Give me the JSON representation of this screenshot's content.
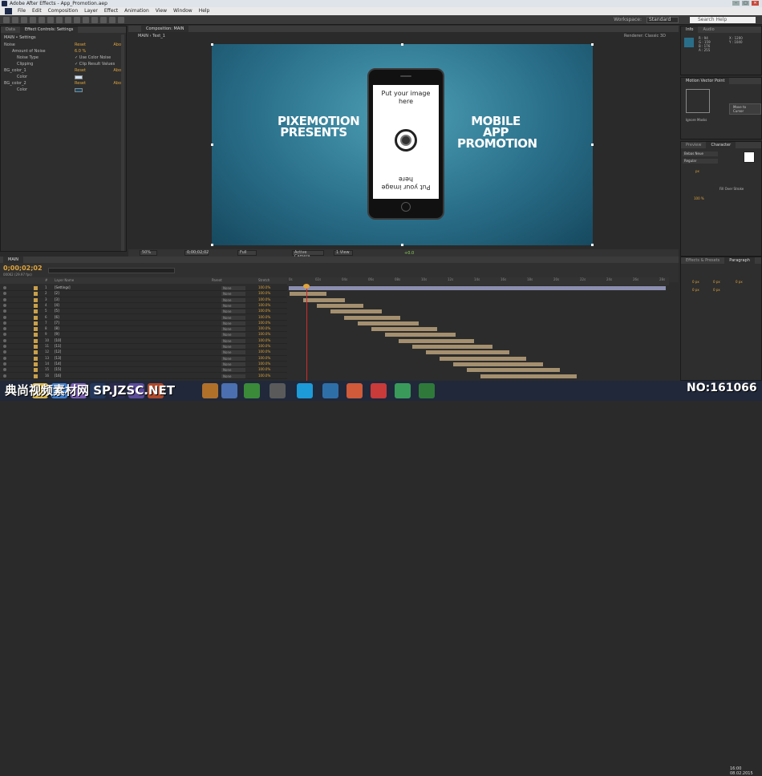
{
  "window": {
    "title": "Adobe After Effects - App_Promotion.aep",
    "buttons": [
      "–",
      "□",
      "✕"
    ]
  },
  "menu": [
    "File",
    "Edit",
    "Composition",
    "Layer",
    "Effect",
    "Animation",
    "View",
    "Window",
    "Help"
  ],
  "toolbar": {
    "workspace_label": "Workspace:",
    "workspace_value": "Standard",
    "search_placeholder": "Search Help"
  },
  "effect_controls": {
    "tabs": [
      "Data",
      "Effect Controls: Settings"
    ],
    "path": "MAIN • Settings",
    "rows": [
      {
        "label": "Noise",
        "reset": "Reset",
        "about": "Abo"
      },
      {
        "label": "Amount of Noise",
        "value": "6.0 %"
      },
      {
        "label": "Noise Type",
        "value": "✓ Use Color Noise"
      },
      {
        "label": "Clipping",
        "value": "✓ Clip Result Values"
      },
      {
        "label": "BG_color_1",
        "reset": "Reset",
        "about": "Abo"
      },
      {
        "label": "Color",
        "swatch": true
      },
      {
        "label": "BG_color_2",
        "reset": "Reset",
        "about": "Abo"
      },
      {
        "label": "Color",
        "swatch": true
      }
    ]
  },
  "composition": {
    "tab": "Composition: MAIN",
    "crumbs": [
      "MAIN",
      "Text_1"
    ],
    "renderer_label": "Renderer:",
    "renderer_value": "Classic 3D",
    "left_text": "PIXEMOTION PRESENTS",
    "right_text": "MOBILE APP PROMOTION",
    "screen_top": "Put your image here",
    "screen_bottom": "Put your image here",
    "footer": {
      "zoom": "50%",
      "timecode": "0;00;02;02",
      "resolution": "Full",
      "camera": "Active Camera",
      "views": "1 View",
      "exposure": "+0.0"
    }
  },
  "right_panels": {
    "info": {
      "tabs": [
        "Info",
        "Audio"
      ],
      "lines": [
        "R : 94",
        "G : 159",
        "B : 176",
        "A : 255"
      ],
      "coords": [
        "X : 1200",
        "Y : 1040"
      ]
    },
    "motion": {
      "title": "Motion Vector Point",
      "button": "Move to Cursor",
      "ignore": "Ignore Masks"
    },
    "character": {
      "tabs": [
        "Preview",
        "Character"
      ],
      "font": "Bebas Neue",
      "style": "Regular",
      "size": "px",
      "stroke": "Fill Over Stroke",
      "scale": "100 %"
    },
    "paragraph": {
      "tabs": [
        "Effects & Presets",
        "Paragraph"
      ],
      "values": [
        "0 px",
        "0 px",
        "0 px",
        "0 px",
        "0 px"
      ]
    }
  },
  "timeline": {
    "tab": "MAIN",
    "timecode": "0;00;02;02",
    "fps": "00062 (29.97 fps)",
    "headers": [
      "#",
      "Layer Name",
      "Parent",
      "Stretch"
    ],
    "ruler": [
      "0s",
      "02s",
      "04s",
      "06s",
      "08s",
      "10s",
      "12s",
      "14s",
      "16s",
      "18s",
      "20s",
      "22s",
      "24s",
      "26s",
      "28s"
    ],
    "layers": [
      {
        "num": "1",
        "name": "[Settings]",
        "parent": "None",
        "stretch": "100.0%"
      },
      {
        "num": "2",
        "name": "[2]",
        "parent": "None",
        "stretch": "100.0%"
      },
      {
        "num": "3",
        "name": "[3]",
        "parent": "None",
        "stretch": "100.0%"
      },
      {
        "num": "4",
        "name": "[4]",
        "parent": "None",
        "stretch": "100.0%"
      },
      {
        "num": "5",
        "name": "[5]",
        "parent": "None",
        "stretch": "100.0%"
      },
      {
        "num": "6",
        "name": "[6]",
        "parent": "None",
        "stretch": "100.0%"
      },
      {
        "num": "7",
        "name": "[7]",
        "parent": "None",
        "stretch": "100.0%"
      },
      {
        "num": "8",
        "name": "[8]",
        "parent": "None",
        "stretch": "100.0%"
      },
      {
        "num": "9",
        "name": "[9]",
        "parent": "None",
        "stretch": "100.0%"
      },
      {
        "num": "10",
        "name": "[10]",
        "parent": "None",
        "stretch": "100.0%"
      },
      {
        "num": "11",
        "name": "[11]",
        "parent": "None",
        "stretch": "100.0%"
      },
      {
        "num": "12",
        "name": "[12]",
        "parent": "None",
        "stretch": "100.0%"
      },
      {
        "num": "13",
        "name": "[13]",
        "parent": "None",
        "stretch": "100.0%"
      },
      {
        "num": "14",
        "name": "[14]",
        "parent": "None",
        "stretch": "100.0%"
      },
      {
        "num": "15",
        "name": "[15]",
        "parent": "None",
        "stretch": "100.0%"
      },
      {
        "num": "16",
        "name": "[16]",
        "parent": "None",
        "stretch": "100.0%"
      }
    ]
  },
  "taskbar": {
    "clock_time": "16:00",
    "clock_date": "08.02.2015"
  },
  "watermark": {
    "left": "典尚视频素材网 SP.JZSC.NET",
    "right": "NO:161066"
  },
  "colors": {
    "accent": "#e0a43a",
    "canvas": "#2a6f8a",
    "cti": "#d02b2b"
  }
}
